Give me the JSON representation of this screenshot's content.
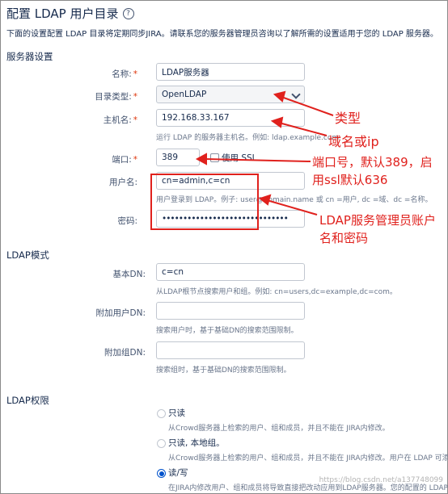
{
  "page": {
    "title": "配置 LDAP 用户目录",
    "description": "下面的设置配置 LDAP 目录将定期同步JIRA。请联系您的服务器管理员咨询以了解所需的设置适用于您的 LDAP 服务器。"
  },
  "server_settings": {
    "section_title": "服务器设置",
    "name_label": "名称:",
    "name_value": "LDAP服务器",
    "dir_type_label": "目录类型:",
    "dir_type_value": "OpenLDAP",
    "hostname_label": "主机名:",
    "hostname_value": "192.168.33.167",
    "hostname_hint": "运行 LDAP 的服务器主机名。例如: ldap.example.com",
    "port_label": "端口:",
    "port_value": "389",
    "use_ssl_label": "使用 SSL",
    "username_label": "用户名:",
    "username_value": "cn=admin,c=cn",
    "username_hint": "用户登录到 LDAP。例子: user@domain.name 或 cn =用户, dc =域、dc =名称。",
    "password_label": "密码:",
    "password_value": "••••••••••••••••••••••••••••••"
  },
  "ldap_schema": {
    "section_title": "LDAP模式",
    "base_dn_label": "基本DN:",
    "base_dn_value": "c=cn",
    "base_dn_hint": "从LDAP根节点搜索用户和组。例如: cn=users,dc=example,dc=com。",
    "add_user_dn_label": "附加用户DN:",
    "add_user_dn_value": "",
    "add_user_dn_hint": "搜索用户时，基于基础DN的搜索范围限制。",
    "add_group_dn_label": "附加组DN:",
    "add_group_dn_value": "",
    "add_group_dn_hint": "搜索组时，基于基础DN的搜索范围限制。"
  },
  "ldap_permissions": {
    "section_title": "LDAP权限",
    "options": [
      {
        "label": "只读",
        "desc": "从Crowd服务器上检索的用户、组和成员，并且不能在 JIRA内修改。",
        "selected": false
      },
      {
        "label": "只读, 本地组。",
        "desc": "从Crowd服务器上检索的用户、组和成员，并且不能在 JIRA内修改。用户在 LDAP 可添加",
        "selected": false
      },
      {
        "label": "读/写",
        "desc": "在JIRA内修改用户、组和成员将导致直接把改动应用到LDAP服务器。您的配置的 LDAP 服",
        "selected": true
      }
    ]
  },
  "annotations": {
    "type": "类型",
    "hostname": "域名或ip",
    "port_line1": "端口号，默认389，启",
    "port_line2": "用ssl默认636",
    "admin_line1": "LDAP服务管理员账户",
    "admin_line2": "名和密码",
    "color": "#e0211d"
  },
  "watermark": "https://blog.csdn.net/a137748099"
}
